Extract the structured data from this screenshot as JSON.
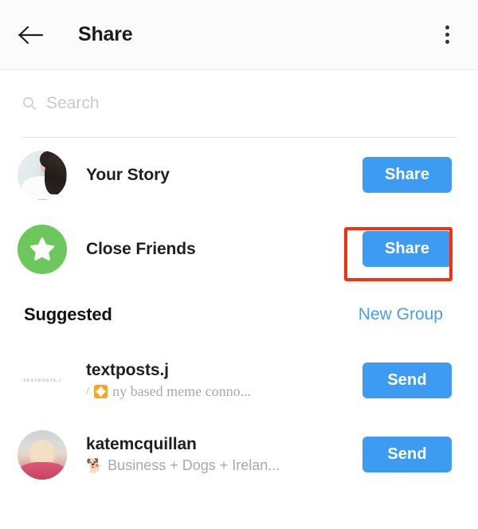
{
  "header": {
    "title": "Share",
    "back_icon": "arrow-left-icon",
    "menu_icon": "more-vertical-icon"
  },
  "search": {
    "placeholder": "Search",
    "value": "",
    "icon": "search-icon"
  },
  "destinations": [
    {
      "name": "Your Story",
      "avatar_type": "photo",
      "avatar_alt": "your-story-profile-photo",
      "action_label": "Share",
      "highlighted": false
    },
    {
      "name": "Close Friends",
      "avatar_type": "star",
      "avatar_alt": "close-friends-star-icon",
      "action_label": "Share",
      "highlighted": true
    }
  ],
  "section": {
    "title": "Suggested",
    "link_label": "New Group"
  },
  "suggested": [
    {
      "username": "textposts.j",
      "subtitle": "ny based meme conno...",
      "subtitle_prefix": "/",
      "subtitle_emoji": "sun-emoji",
      "avatar_type": "logo",
      "avatar_text": "TEXTPOSTS.J",
      "action_label": "Send"
    },
    {
      "username": "katemcquillan",
      "subtitle": "Business + Dogs + Irelan...",
      "subtitle_emoji": "🐕",
      "avatar_type": "photo",
      "avatar_alt": "katemcquillan-profile-photo",
      "action_label": "Send"
    }
  ],
  "colors": {
    "accent_blue": "#3e9bf2",
    "link_blue": "#4a9cf0",
    "close_friends_green": "#6cc75c",
    "highlight_red": "#f82f0c"
  }
}
